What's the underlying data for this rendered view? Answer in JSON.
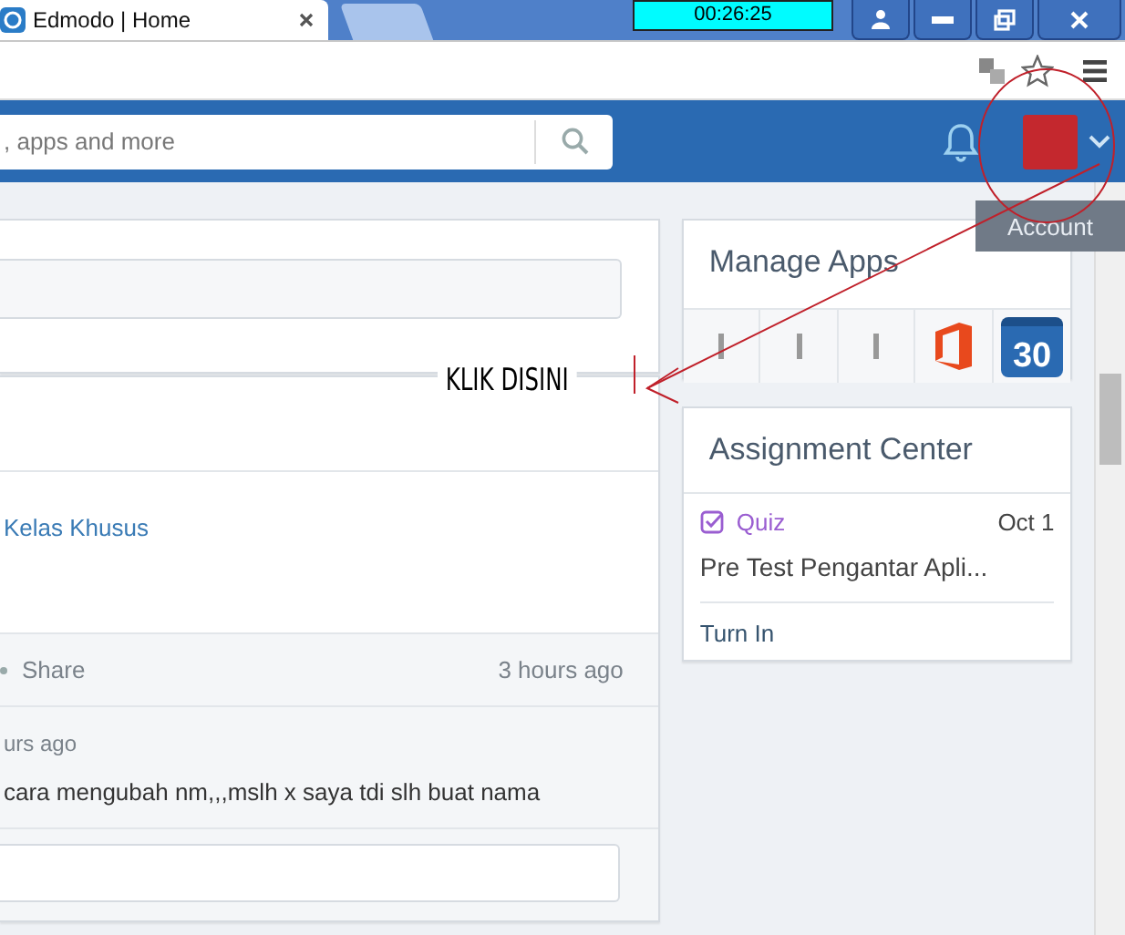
{
  "browser": {
    "tab": {
      "title": "Edmodo | Home"
    },
    "timer": "00:26:25"
  },
  "search": {
    "placeholder": ", apps and more"
  },
  "tooltip": "Account",
  "annotation": {
    "text": "KLIK DISINI"
  },
  "post": {
    "group_link": "Kelas Khusus",
    "actions": [
      "Share"
    ],
    "timestamp": "3 hours ago"
  },
  "comment": {
    "time": "urs ago",
    "text": "cara mengubah nm,,,mslh x saya tdi slh buat nama"
  },
  "manage_apps": {
    "title": "Manage Apps",
    "apps": [
      {
        "kind": "partial"
      },
      {
        "kind": "partial"
      },
      {
        "kind": "partial"
      },
      {
        "kind": "office"
      },
      {
        "kind": "calendar",
        "label": "30"
      }
    ]
  },
  "assignment_center": {
    "title": "Assignment Center",
    "items": [
      {
        "type": "Quiz",
        "due": "Oct 1",
        "title": "Pre Test Pengantar Apli...",
        "action": "Turn In"
      }
    ]
  }
}
